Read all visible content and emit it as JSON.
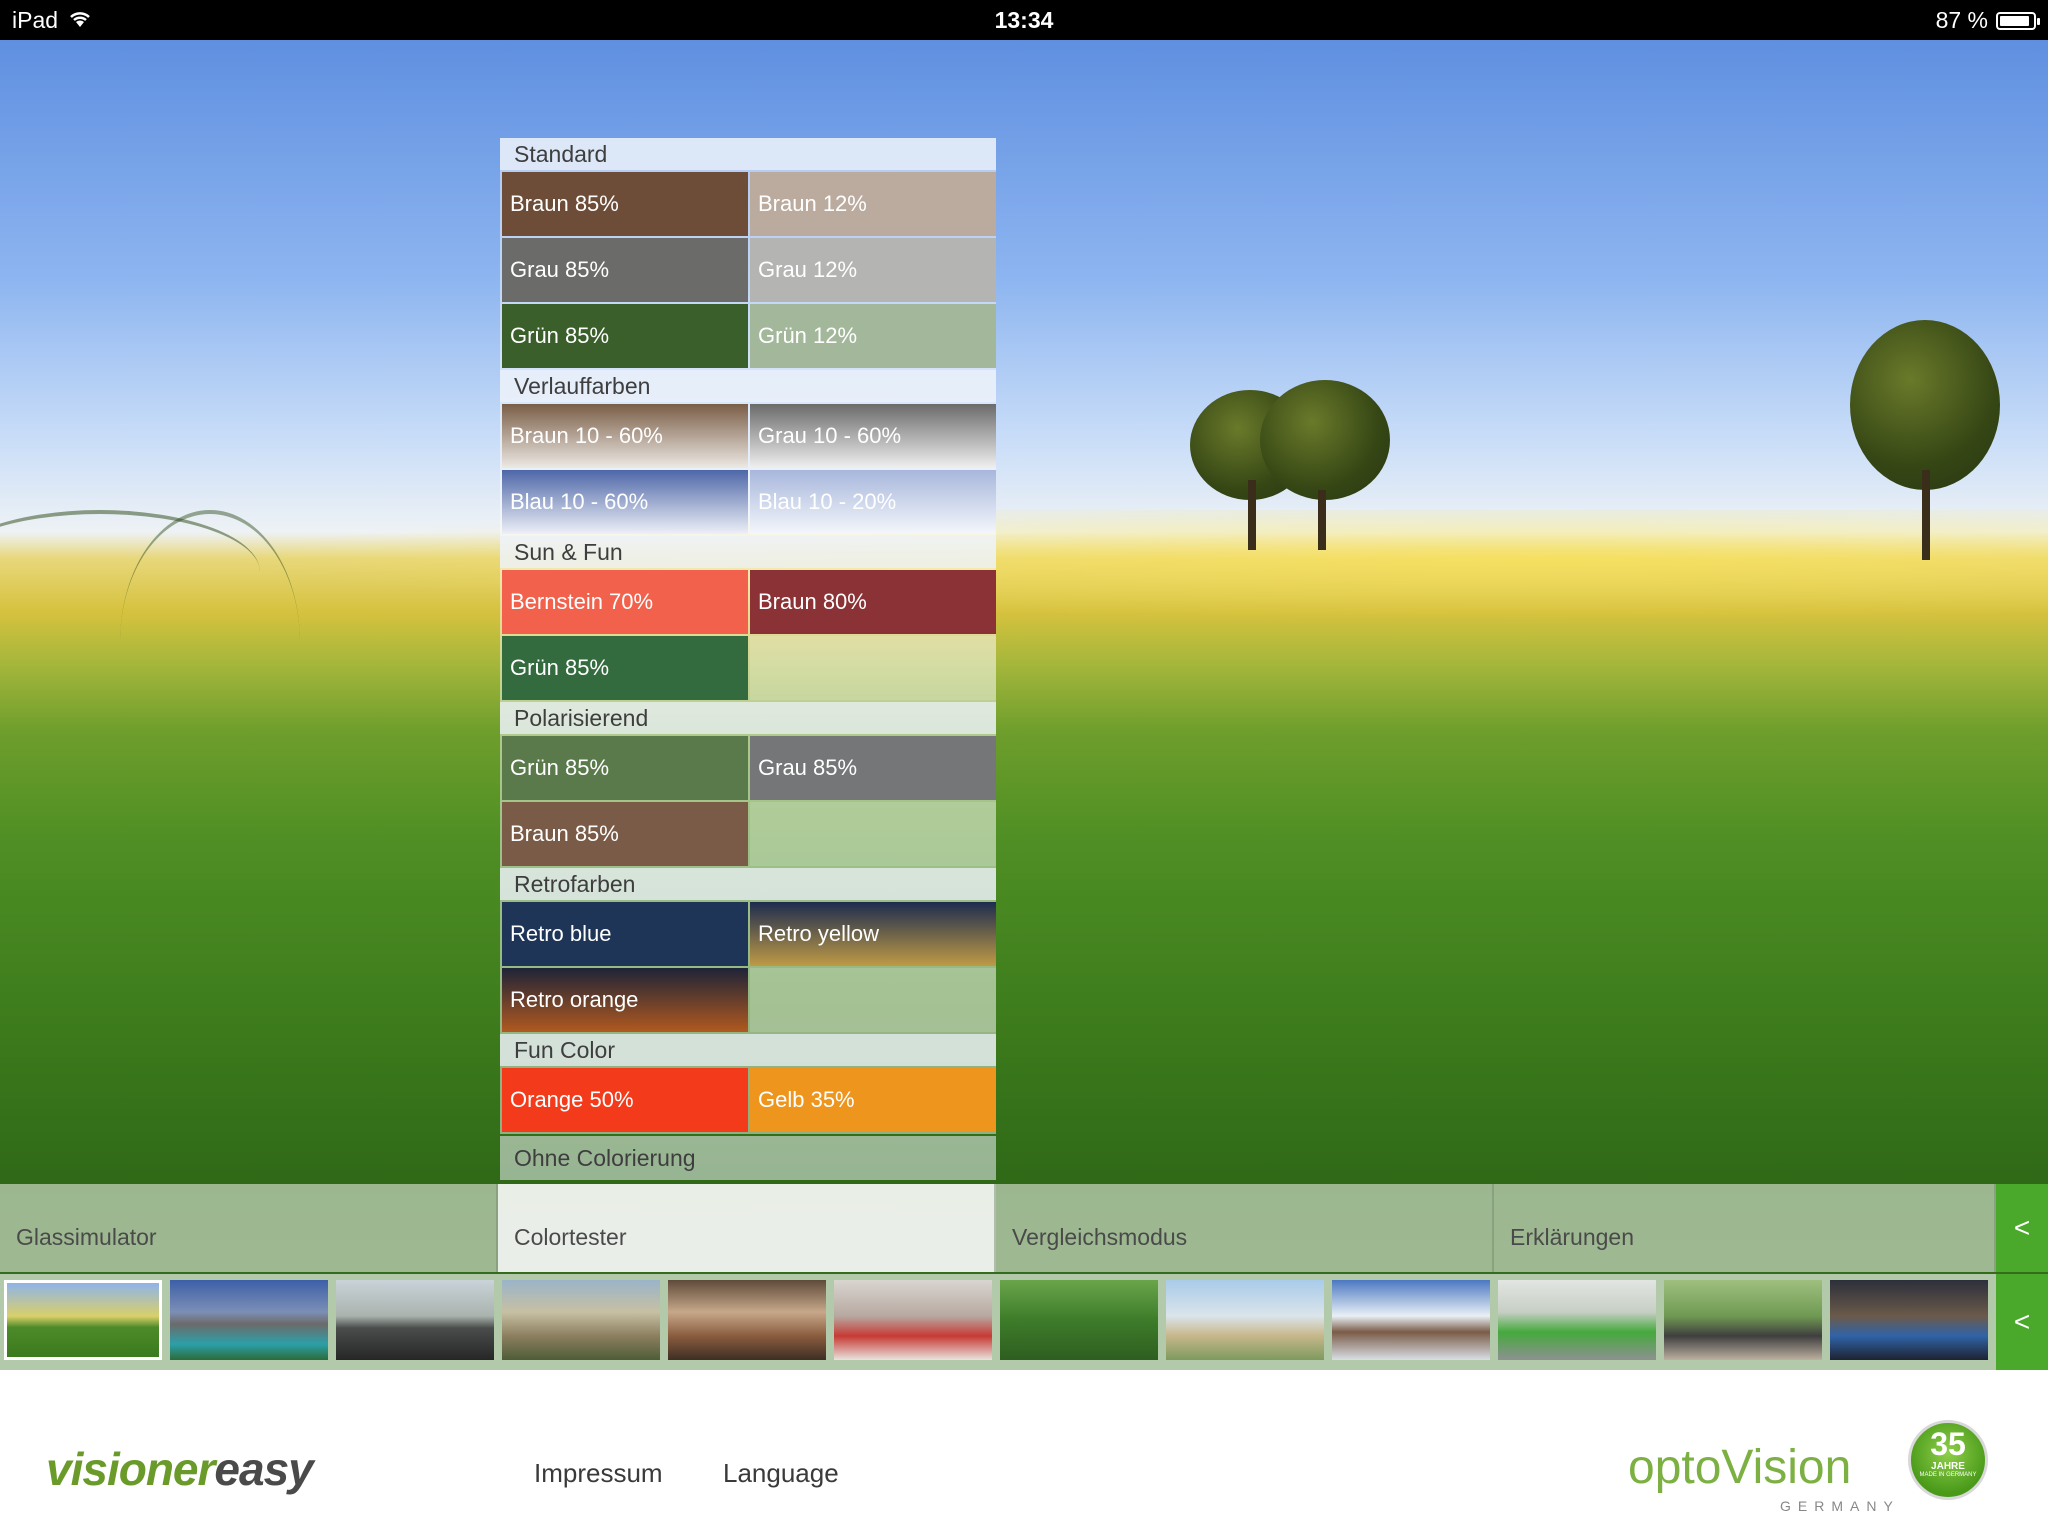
{
  "status_bar": {
    "device": "iPad",
    "time": "13:34",
    "battery": "87 %"
  },
  "panel": {
    "sections": [
      {
        "title": "Standard",
        "swatches": [
          {
            "label": "Braun 85%",
            "color": "#6d4d37"
          },
          {
            "label": "Braun 12%",
            "color": "#bbab9f"
          },
          {
            "label": "Grau 85%",
            "color": "#6b6c69"
          },
          {
            "label": "Grau 12%",
            "color": "#b4b4b2"
          },
          {
            "label": "Grün 85%",
            "color": "#3a5f2b"
          },
          {
            "label": "Grün 12%",
            "color": "#a3b89b"
          }
        ]
      },
      {
        "title": "Verlauffarben",
        "swatches": [
          {
            "label": "Braun 10 - 60%",
            "color": "linear-gradient(#7a5e47,#ede9e4)"
          },
          {
            "label": "Grau 10 - 60%",
            "color": "linear-gradient(#6b6b6b,#efefef)"
          },
          {
            "label": "Blau 10 - 60%",
            "color": "linear-gradient(#4e67a8,#eef0f7)"
          },
          {
            "label": "Blau 10 - 20%",
            "color": "linear-gradient(#a7b6db,#f4f6fb)"
          }
        ]
      },
      {
        "title": "Sun & Fun",
        "swatches": [
          {
            "label": "Bernstein 70%",
            "color": "#f2614b"
          },
          {
            "label": "Braun 80%",
            "color": "#8a3235"
          },
          {
            "label": "Grün 85%",
            "color": "#336b3f"
          },
          {
            "label": "",
            "color": ""
          }
        ]
      },
      {
        "title": "Polarisierend",
        "swatches": [
          {
            "label": "Grün 85%",
            "color": "#5b7a4b"
          },
          {
            "label": "Grau 85%",
            "color": "#747677"
          },
          {
            "label": "Braun 85%",
            "color": "#7a5b47"
          },
          {
            "label": "",
            "color": ""
          }
        ]
      },
      {
        "title": "Retrofarben",
        "swatches": [
          {
            "label": "Retro blue",
            "color": "#1e3558"
          },
          {
            "label": "Retro yellow",
            "color": "linear-gradient(#1d2c4f,#bf9a45)"
          },
          {
            "label": "Retro orange",
            "color": "linear-gradient(#1f2438,#b0591f)"
          },
          {
            "label": "",
            "color": ""
          }
        ]
      },
      {
        "title": "Fun Color",
        "swatches": [
          {
            "label": "Orange 50%",
            "color": "#f33b1c"
          },
          {
            "label": "Gelb 35%",
            "color": "#ee951e"
          }
        ]
      }
    ],
    "ohne": "Ohne Colorierung"
  },
  "tabs": [
    "Glassimulator",
    "Colortester",
    "Vergleichsmodus",
    "Erklärungen"
  ],
  "tab_arrow": "<",
  "thumbs_arrow": "<",
  "thumbnails": [
    {
      "name": "wheat-field",
      "color": "linear-gradient(#8fb3ea 0%,#d9d06a 45%,#4d8a28 60%,#3b7a1e 100%)"
    },
    {
      "name": "mountain-lake",
      "color": "linear-gradient(#3d5fa8 0%,#7c8fb5 40%,#6b6a6a 55%,#2ca0a8 80%,#2d6a3a 100%)"
    },
    {
      "name": "car-driving",
      "color": "linear-gradient(#c9d3d9 0%,#aab3ad 45%,#4a4d4c 60%,#262626 100%)"
    },
    {
      "name": "hiker-map",
      "color": "linear-gradient(#9ab4c9 0%,#c7c0a3 40%,#8b7f5f 70%,#4f5c37 100%)"
    },
    {
      "name": "kitchen-cooking",
      "color": "linear-gradient(#5f4a3a 0%,#c7a88a 40%,#8a5c3e 70%,#3e2e24 100%)"
    },
    {
      "name": "living-room",
      "color": "linear-gradient(#d9d5d0 0%,#b7a9a1 45%,#c73a34 70%,#e9e4df 100%)"
    },
    {
      "name": "forest",
      "color": "linear-gradient(#6aa54a 0%,#3e7c2a 50%,#2e5e20 100%)"
    },
    {
      "name": "cyclist-beach",
      "color": "linear-gradient(#a9cbe9 0%,#dbe4ea 45%,#c6b78a 70%,#7d9a5e 100%)"
    },
    {
      "name": "skier-camera",
      "color": "linear-gradient(#4b78c2 0%,#e9f0f5 45%,#7a5b47 65%,#d9dfe5 100%)"
    },
    {
      "name": "office-monitor",
      "color": "linear-gradient(#e2e5e2 0%,#c7cfc5 40%,#45a93d 65%,#8d9190 100%)"
    },
    {
      "name": "tablet-park",
      "color": "linear-gradient(#9fbf7f 0%,#6f9a53 45%,#3f3f3f 70%,#bdb0a0 100%)"
    },
    {
      "name": "city-night-phone",
      "color": "linear-gradient(#2c2f3b 0%,#6b5a4a 45%,#2f63a8 70%,#1e2230 100%)"
    }
  ],
  "footer": {
    "logo_left_a": "visioner",
    "logo_left_b": "easy",
    "impressum": "Impressum",
    "language": "Language",
    "logo_right_a": "opto",
    "logo_right_b": "Vision",
    "logo_germany": "GERMANY",
    "badge_num": "35",
    "badge_yrs": "JAHRE",
    "badge_made": "MADE IN GERMANY"
  },
  "colors": {
    "accent_green": "#4aa82a",
    "logo_green": "#7db043"
  }
}
